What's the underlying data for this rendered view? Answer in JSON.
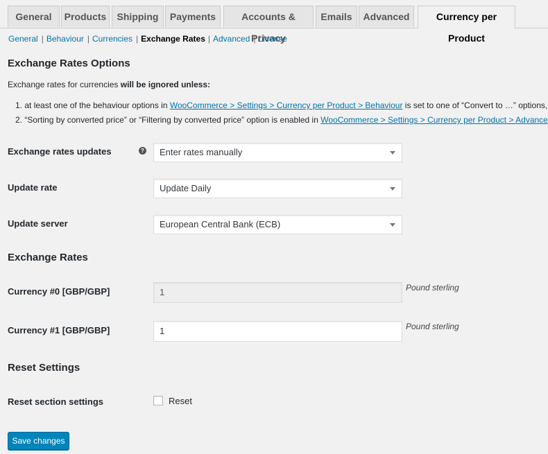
{
  "tabs": [
    "General",
    "Products",
    "Shipping",
    "Payments",
    "Accounts & Privacy",
    "Emails",
    "Advanced",
    "Currency per Product"
  ],
  "subnav": [
    "General",
    "Behaviour",
    "Currencies",
    "Exchange Rates",
    "Advanced",
    "License"
  ],
  "options_heading": "Exchange Rates Options",
  "intro": {
    "text": "Exchange rates for currencies ",
    "bold": "will be ignored unless:"
  },
  "list": [
    {
      "num": "1.",
      "before": "at least one of the behaviour options in ",
      "link": "WooCommerce > Settings > Currency per Product > Behaviour",
      "after": " is set to one of “Convert to …” options, or"
    },
    {
      "num": "2.",
      "before": "“Sorting by converted price” or “Filtering by converted price” option is enabled in ",
      "link": "WooCommerce > Settings > Currency per Product > Advanced",
      "after": "."
    }
  ],
  "updates_label": "Exchange rates updates",
  "help_icon": "?",
  "updates_value": "Enter rates manually",
  "rate_label": "Update rate",
  "rate_value": "Update Daily",
  "server_label": "Update server",
  "server_value": "European Central Bank (ECB)",
  "rates_heading": "Exchange Rates",
  "currency0": {
    "label": "Currency #0 [GBP/GBP]",
    "value": "1",
    "desc": "Pound sterling"
  },
  "currency1": {
    "label": "Currency #1 [GBP/GBP]",
    "value": "1",
    "desc": "Pound sterling"
  },
  "reset_heading": "Reset Settings",
  "reset_label": "Reset section settings",
  "reset_checkbox_label": "Reset",
  "save_label": "Save changes"
}
